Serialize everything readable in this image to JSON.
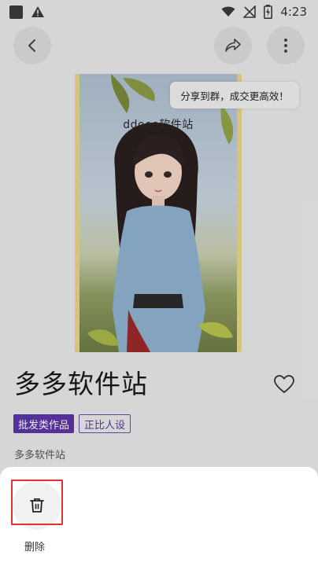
{
  "status_bar": {
    "time": "4:23",
    "left_icons": [
      "square-app-icon",
      "warning-icon"
    ],
    "right_icons": [
      "wifi-icon",
      "signal-off-icon",
      "battery-charging-icon"
    ]
  },
  "toolbar": {
    "back_icon": "chevron-left-icon",
    "share_icon": "share-icon",
    "more_icon": "more-vertical-icon"
  },
  "cover": {
    "watermark_text": "ddooo软件站"
  },
  "toast": {
    "text": "分享到群，成交更高效！"
  },
  "work": {
    "title": "多多软件站",
    "tags": [
      "批发类作品",
      "正比人设"
    ],
    "subtitle": "多多软件站",
    "favorite_icon": "heart-outline-icon"
  },
  "sheet": {
    "delete_icon": "trash-icon",
    "delete_label": "删除",
    "highlight_color": "#e0332f"
  },
  "colors": {
    "tag_filled_bg": "#5b35a8",
    "tag_outline": "#6b4aa8"
  }
}
